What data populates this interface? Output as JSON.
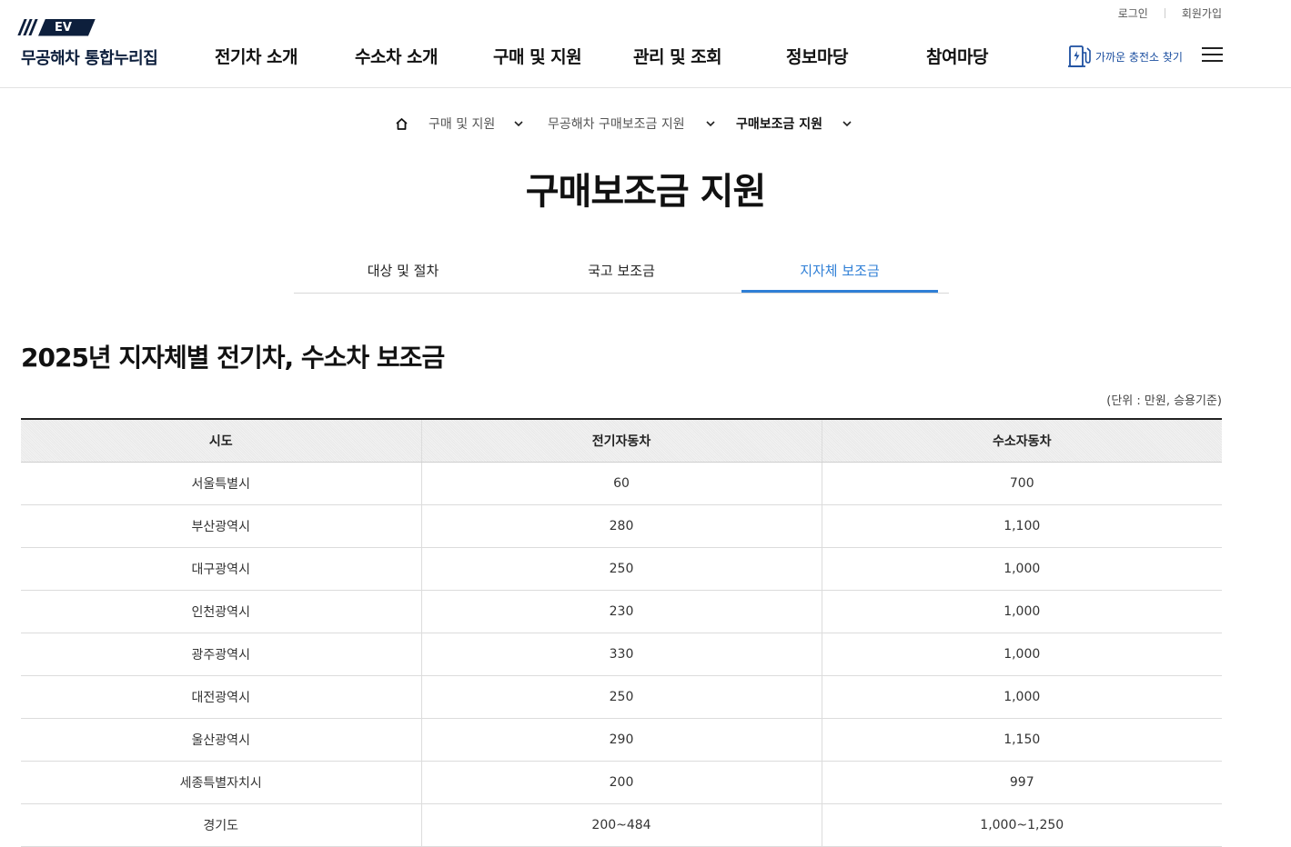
{
  "header": {
    "logo_badge": "EV",
    "site_name": "무공해차 통합누리집",
    "util": {
      "login": "로그인",
      "signup": "회원가입"
    },
    "nav": [
      "전기차 소개",
      "수소차 소개",
      "구매 및 지원",
      "관리 및 조회",
      "정보마당",
      "참여마당"
    ],
    "charge_station": "가까운 충전소 찾기"
  },
  "breadcrumb": {
    "items": [
      "구매 및 지원",
      "무공해차 구매보조금 지원",
      "구매보조금 지원"
    ]
  },
  "page_title": "구매보조금 지원",
  "tabs": [
    {
      "label": "대상 및 절차",
      "active": false
    },
    {
      "label": "국고 보조금",
      "active": false
    },
    {
      "label": "지자체 보조금",
      "active": true
    }
  ],
  "section": {
    "title": "2025년 지자체별 전기차, 수소차 보조금",
    "unit_note": "(단위 : 만원, 승용기준)"
  },
  "table": {
    "headers": [
      "시도",
      "전기자동차",
      "수소자동차"
    ],
    "rows": [
      [
        "서울특별시",
        "60",
        "700"
      ],
      [
        "부산광역시",
        "280",
        "1,100"
      ],
      [
        "대구광역시",
        "250",
        "1,000"
      ],
      [
        "인천광역시",
        "230",
        "1,000"
      ],
      [
        "광주광역시",
        "330",
        "1,000"
      ],
      [
        "대전광역시",
        "250",
        "1,000"
      ],
      [
        "울산광역시",
        "290",
        "1,150"
      ],
      [
        "세종특별자치시",
        "200",
        "997"
      ],
      [
        "경기도",
        "200~484",
        "1,000~1,250"
      ]
    ]
  },
  "colors": {
    "accent": "#2f7fd6",
    "brand": "#0d1f3c",
    "charge_link": "#1c4fa0"
  }
}
